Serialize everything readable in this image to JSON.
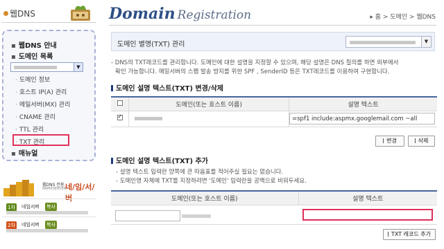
{
  "sidebar": {
    "title": "웹DNS",
    "menu": [
      {
        "label": "웹DNS 안내"
      },
      {
        "label": "도메인 목록"
      }
    ],
    "sub_items": [
      {
        "label": "도메인 정보"
      },
      {
        "label": "호스트 IP(A) 관리"
      },
      {
        "label": "메일서버(MX) 관리"
      },
      {
        "label": "CNAME 관리"
      },
      {
        "label": "TTL 관리"
      },
      {
        "label": "TXT 관리"
      }
    ],
    "manual": {
      "label": "매뉴얼"
    },
    "promo": {
      "line1": "웹DNS 전용",
      "line2": "NAMESERVER",
      "big": "네/임/서/버"
    },
    "nameservers": [
      {
        "tag": "1차",
        "label": "네임서버",
        "copy": "복사"
      },
      {
        "tag": "2차",
        "label": "네임서버",
        "copy": "복사"
      }
    ],
    "colors": {
      "tag1": "#5f8a1a",
      "tag2": "#d2521b",
      "highlight": "#e0305a"
    }
  },
  "header": {
    "title_main": "Domain",
    "title_sub": "Registration",
    "breadcrumb": "▸ 홈 > 도메인 > 웹DNS"
  },
  "main": {
    "select_label": "도메인 별명(TXT) 관리",
    "description": [
      "- DNS의 TXT레코드를 관리합니다. 도메인에 대한 설명을 지정할 수 있으며, 해당 설명은 DNS 질의를 하면 외부에서",
      "  확인 가능합니다. 메일서버의 스팸 발송 방지를 위한 SPF , SenderID 등은 TXT레코드를 이용하여 구현합니다."
    ],
    "edit_section": {
      "title": "도메인 설명 텍스트(TXT) 변경/삭제",
      "col_domain": "도메인(또는 호스트 이름)",
      "col_text": "설명 텍스트",
      "row_value": "=spf1 include:aspmx.googlemail.com ~all",
      "btn_change": "변경",
      "btn_delete": "삭제"
    },
    "add_section": {
      "title": "도메인 설명 텍스트(TXT) 추가",
      "notes": [
        "- 설명 텍스트 입력란 양쪽에 큰 따옴표를 적어주실 필요는 없습니다.",
        "- 도메인명 자체에 TXT를 지정하려면 '도메인' 입력란을 공백으로 비워두세요."
      ],
      "col_domain": "도메인(또는 호스트 이름)",
      "col_text": "설명 텍스트",
      "btn_add": "TXT 레코드 추가"
    }
  }
}
